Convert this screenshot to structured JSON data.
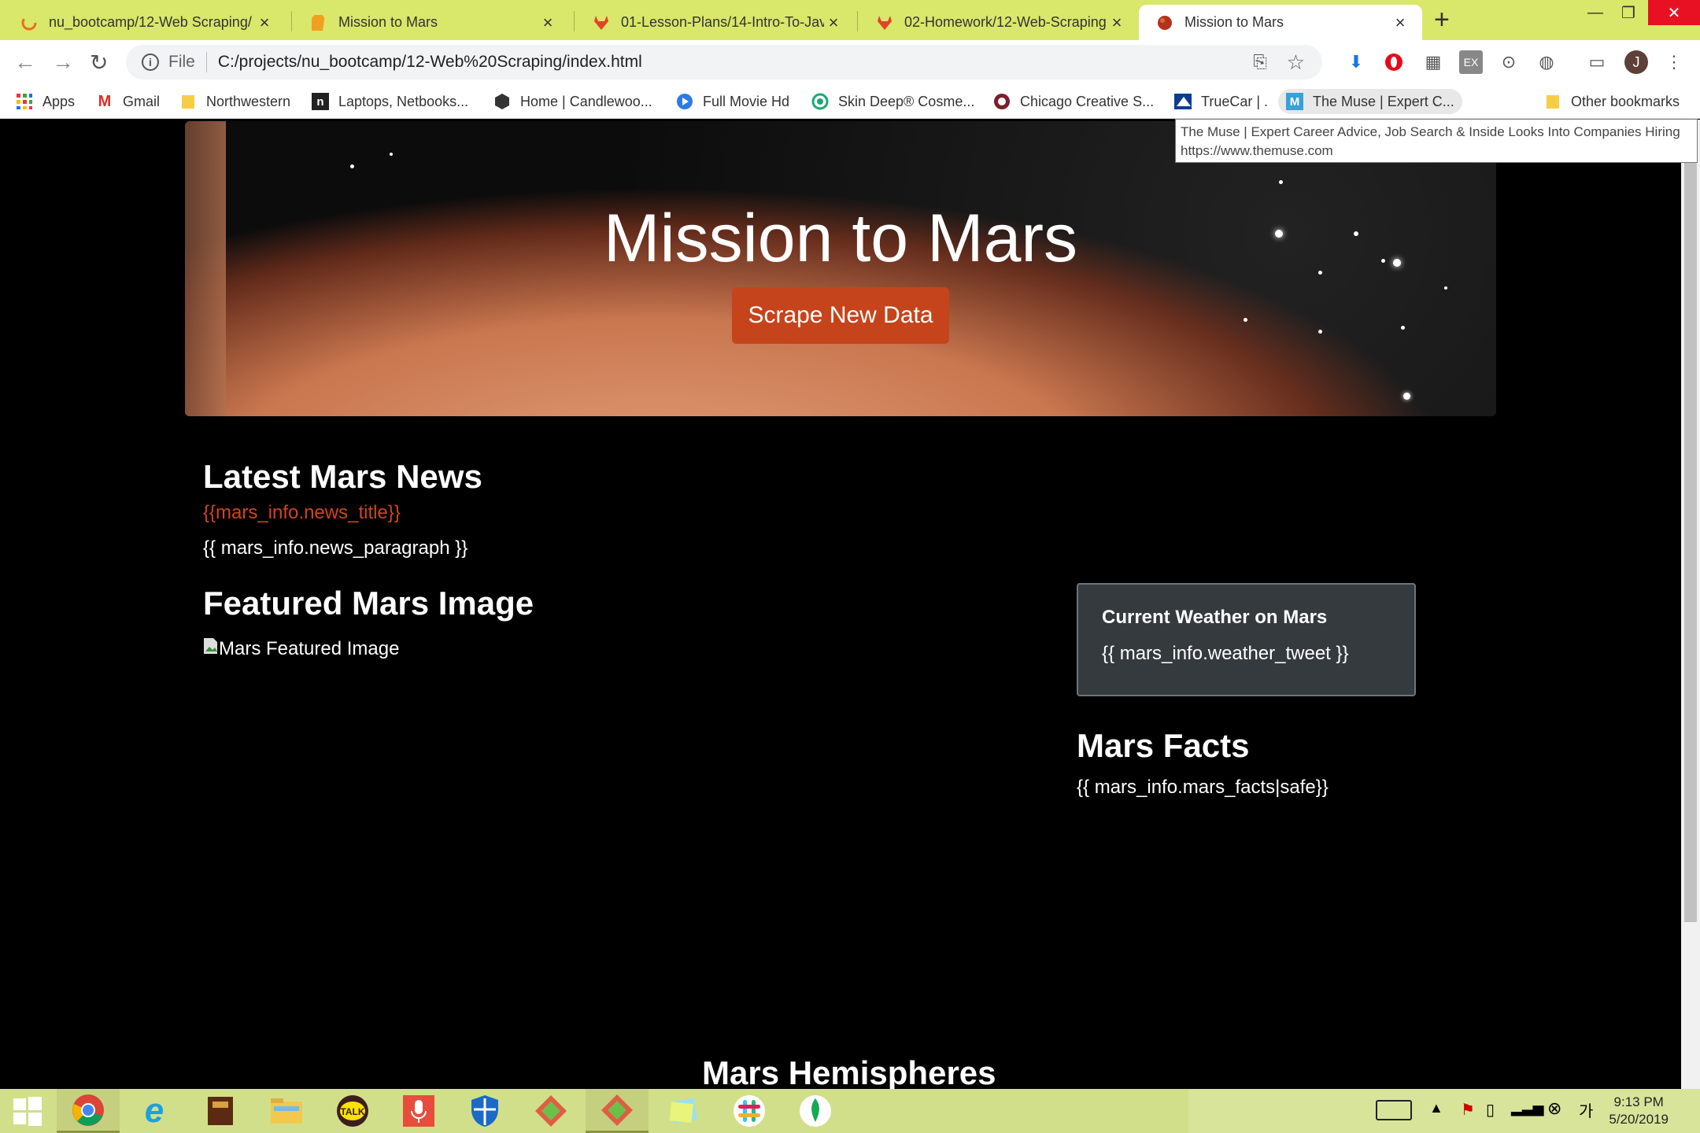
{
  "tabs": [
    {
      "title": "nu_bootcamp/12-Web Scraping/",
      "icon": "loading-icon"
    },
    {
      "title": "Mission to Mars",
      "icon": "document-icon"
    },
    {
      "title": "01-Lesson-Plans/14-Intro-To-Jav",
      "icon": "gitlab-icon"
    },
    {
      "title": "02-Homework/12-Web-Scraping",
      "icon": "gitlab-icon"
    },
    {
      "title": "Mission to Mars",
      "icon": "mars-icon",
      "active": true
    }
  ],
  "address": {
    "scheme_label": "File",
    "url": "C:/projects/nu_bootcamp/12-Web%20Scraping/index.html"
  },
  "bookmarks": [
    {
      "label": "Apps"
    },
    {
      "label": "Gmail"
    },
    {
      "label": "Northwestern"
    },
    {
      "label": "Laptops, Netbooks..."
    },
    {
      "label": "Home | Candlewoo..."
    },
    {
      "label": "Full Movie Hd"
    },
    {
      "label": "Skin Deep® Cosme..."
    },
    {
      "label": "Chicago Creative S..."
    },
    {
      "label": "TrueCar | ."
    },
    {
      "label": "The Muse | Expert C..."
    },
    {
      "label": "Other bookmarks"
    }
  ],
  "tooltip": {
    "line1": "The Muse | Expert Career Advice, Job Search & Inside Looks Into Companies Hiring",
    "line2": "https://www.themuse.com"
  },
  "page": {
    "jumbotron": {
      "title": "Mission to Mars",
      "button": "Scrape New Data"
    },
    "news": {
      "heading": "Latest Mars News",
      "title": "{{mars_info.news_title}}",
      "paragraph": "{{ mars_info.news_paragraph }}"
    },
    "featured": {
      "heading": "Featured Mars Image",
      "alt": "Mars Featured Image"
    },
    "weather": {
      "title": "Current Weather on Mars",
      "body": "{{ mars_info.weather_tweet }}"
    },
    "facts": {
      "heading": "Mars Facts",
      "body": "{{ mars_info.mars_facts|safe}}"
    },
    "hemispheres": {
      "heading": "Mars Hemispheres"
    }
  },
  "profile_initial": "J",
  "clock": {
    "time": "9:13 PM",
    "date": "5/20/2019"
  },
  "colors": {
    "tab_strip": "#d9e76a",
    "accent_button": "#c6441b",
    "news_title": "#d2441d",
    "weather_card": "#353a3f",
    "taskbar": "#d2df8a"
  }
}
